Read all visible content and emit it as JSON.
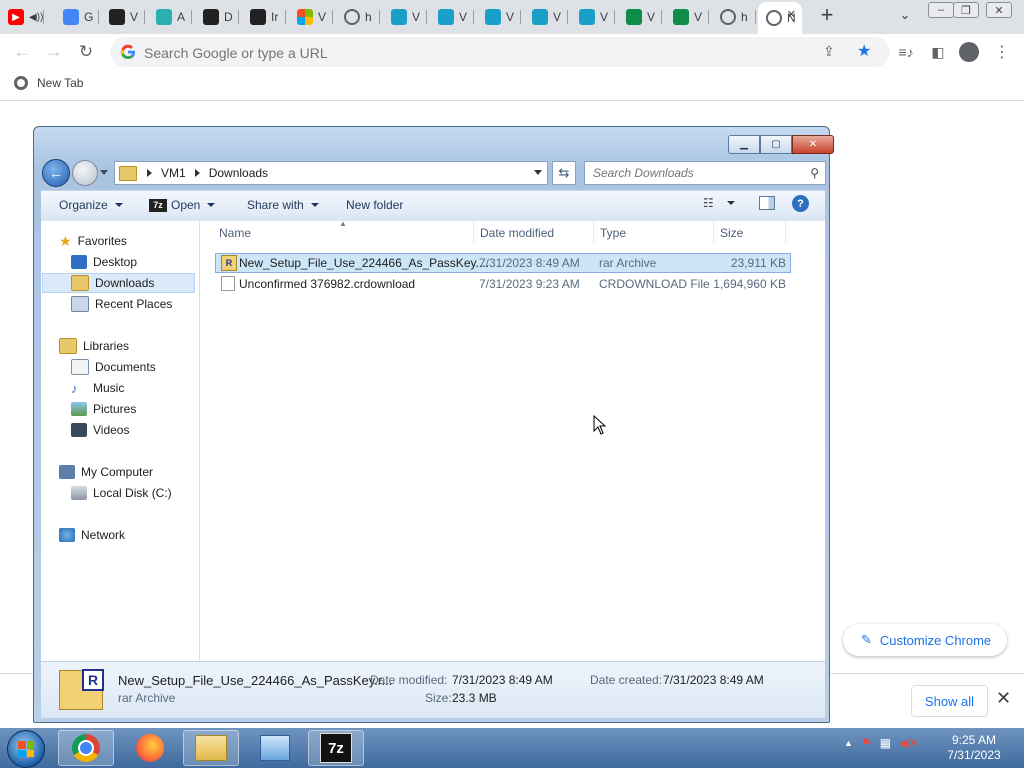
{
  "browser": {
    "tabs": [
      {
        "title": "",
        "icon": "youtube-icon",
        "color": "#ff0000"
      },
      {
        "title": "G",
        "icon": "google-icon",
        "color": "#4285f4"
      },
      {
        "title": "V",
        "icon": "site-icon",
        "color": "#222222"
      },
      {
        "title": "A",
        "icon": "app-icon",
        "color": "#2bb0b0"
      },
      {
        "title": "D",
        "icon": "site-icon",
        "color": "#222222"
      },
      {
        "title": "Ir",
        "icon": "site-icon",
        "color": "#222222"
      },
      {
        "title": "V",
        "icon": "microsoft-icon",
        "color": "#f25022"
      },
      {
        "title": "h",
        "icon": "globe-icon",
        "color": "#5f6368"
      },
      {
        "title": "V",
        "icon": "site-icon",
        "color": "#1aa0c8"
      },
      {
        "title": "V",
        "icon": "site-icon",
        "color": "#1aa0c8"
      },
      {
        "title": "V",
        "icon": "site-icon",
        "color": "#1aa0c8"
      },
      {
        "title": "V",
        "icon": "site-icon",
        "color": "#1aa0c8"
      },
      {
        "title": "V",
        "icon": "site-icon",
        "color": "#1aa0c8"
      },
      {
        "title": "V",
        "icon": "site-icon",
        "color": "#0d8c4a"
      },
      {
        "title": "V",
        "icon": "site-icon",
        "color": "#0d8c4a"
      },
      {
        "title": "h",
        "icon": "globe-icon",
        "color": "#5f6368"
      },
      {
        "title": "N",
        "icon": "new-tab-icon",
        "color": "#5f6368",
        "active": true
      }
    ],
    "new_tab_symbol": "+",
    "close_symbol": "✕",
    "omnibox_placeholder": "Search Google or type a URL",
    "bookmark": "New Tab",
    "customize_label": "Customize Chrome",
    "download_show_all": "Show all",
    "download_close": "✕"
  },
  "explorer": {
    "breadcrumb": [
      "VM1",
      "Downloads"
    ],
    "search_placeholder": "Search Downloads",
    "commands": {
      "organize": "Organize",
      "open": "Open",
      "share_with": "Share with",
      "new_folder": "New folder"
    },
    "open_icon_text": "7z",
    "nav": {
      "favorites": "Favorites",
      "desktop": "Desktop",
      "downloads": "Downloads",
      "recent_places": "Recent Places",
      "libraries": "Libraries",
      "documents": "Documents",
      "music": "Music",
      "pictures": "Pictures",
      "videos": "Videos",
      "my_computer": "My Computer",
      "local_disk": "Local Disk (C:)",
      "network": "Network"
    },
    "columns": {
      "name": "Name",
      "date_modified": "Date modified",
      "type": "Type",
      "size": "Size"
    },
    "files": [
      {
        "name": "New_Setup_File_Use_224466_As_PassKey....",
        "date": "7/31/2023 8:49 AM",
        "type": "rar Archive",
        "size": "23,911 KB",
        "icon": "rar-archive-icon"
      },
      {
        "name": "Unconfirmed 376982.crdownload",
        "date": "7/31/2023 9:23 AM",
        "type": "CRDOWNLOAD File",
        "size": "1,694,960 KB",
        "icon": "file-icon"
      }
    ],
    "details": {
      "name": "New_Setup_File_Use_224466_As_PassKey.r...",
      "type": "rar Archive",
      "date_modified_label": "Date modified:",
      "date_modified": "7/31/2023 8:49 AM",
      "size_label": "Size:",
      "size": "23.3 MB",
      "date_created_label": "Date created:",
      "date_created": "7/31/2023 8:49 AM"
    }
  },
  "taskbar": {
    "time": "9:25 AM",
    "date": "7/31/2023",
    "sevenzip_label": "7z"
  }
}
